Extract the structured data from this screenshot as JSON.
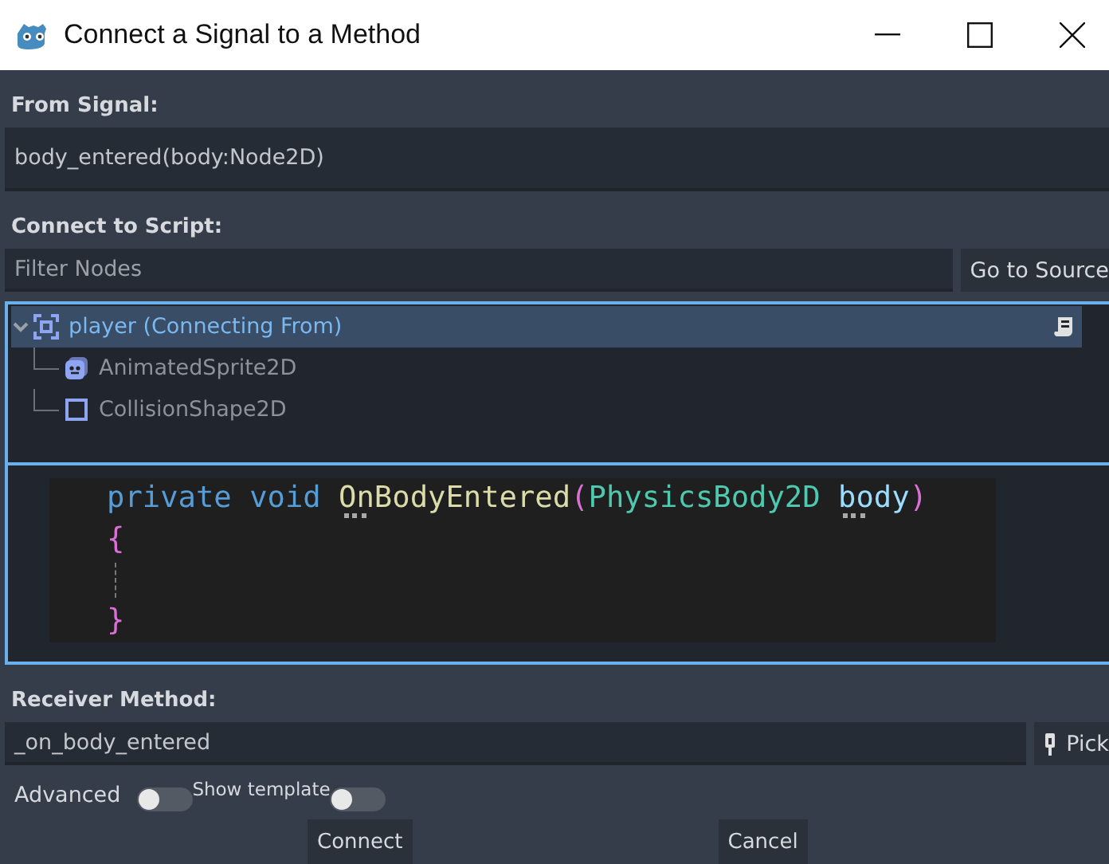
{
  "window": {
    "title": "Connect a Signal to a Method"
  },
  "from_signal": {
    "label": "From Signal:",
    "value": "body_entered(body:Node2D)"
  },
  "connect_to_script": {
    "label": "Connect to Script:",
    "filter": {
      "placeholder": "Filter Nodes"
    },
    "go_to_source_button": "Go to Source"
  },
  "tree": [
    {
      "label": "player (Connecting From)",
      "kind": "node2d",
      "selected": true,
      "expanded": true,
      "has_script": true,
      "children": [
        {
          "label": "AnimatedSprite2D",
          "kind": "sprite",
          "selected": false,
          "has_script": false
        },
        {
          "label": "CollisionShape2D",
          "kind": "shape",
          "selected": false,
          "has_script": false
        }
      ]
    }
  ],
  "code": {
    "lines": [
      {
        "kind": "code",
        "tokens": [
          {
            "kind": "keyword",
            "text": "private ",
            "hinted": false
          },
          {
            "kind": "keyword",
            "text": "void ",
            "hinted": false
          },
          {
            "kind": "function",
            "text": "OnBodyEntered",
            "hinted": true
          },
          {
            "kind": "brace",
            "text": "(",
            "hinted": false
          },
          {
            "kind": "type",
            "text": "PhysicsBody2D ",
            "hinted": false
          },
          {
            "kind": "param",
            "text": "body",
            "hinted": true
          },
          {
            "kind": "brace",
            "text": ")",
            "hinted": false
          }
        ]
      },
      {
        "kind": "code",
        "tokens": [
          {
            "kind": "brace",
            "text": "{",
            "hinted": false
          }
        ]
      },
      {
        "kind": "guide"
      },
      {
        "kind": "code",
        "tokens": [
          {
            "kind": "brace",
            "text": "}",
            "hinted": false
          }
        ]
      }
    ]
  },
  "receiver_method": {
    "label": "Receiver Method:",
    "value": "_on_body_entered",
    "pick_button": "Pick"
  },
  "options": [
    {
      "label": "Advanced",
      "on": false,
      "kind": "plain"
    },
    {
      "label": "Show template",
      "on": false,
      "kind": "compact"
    }
  ],
  "buttons": [
    "Connect",
    "Cancel"
  ]
}
